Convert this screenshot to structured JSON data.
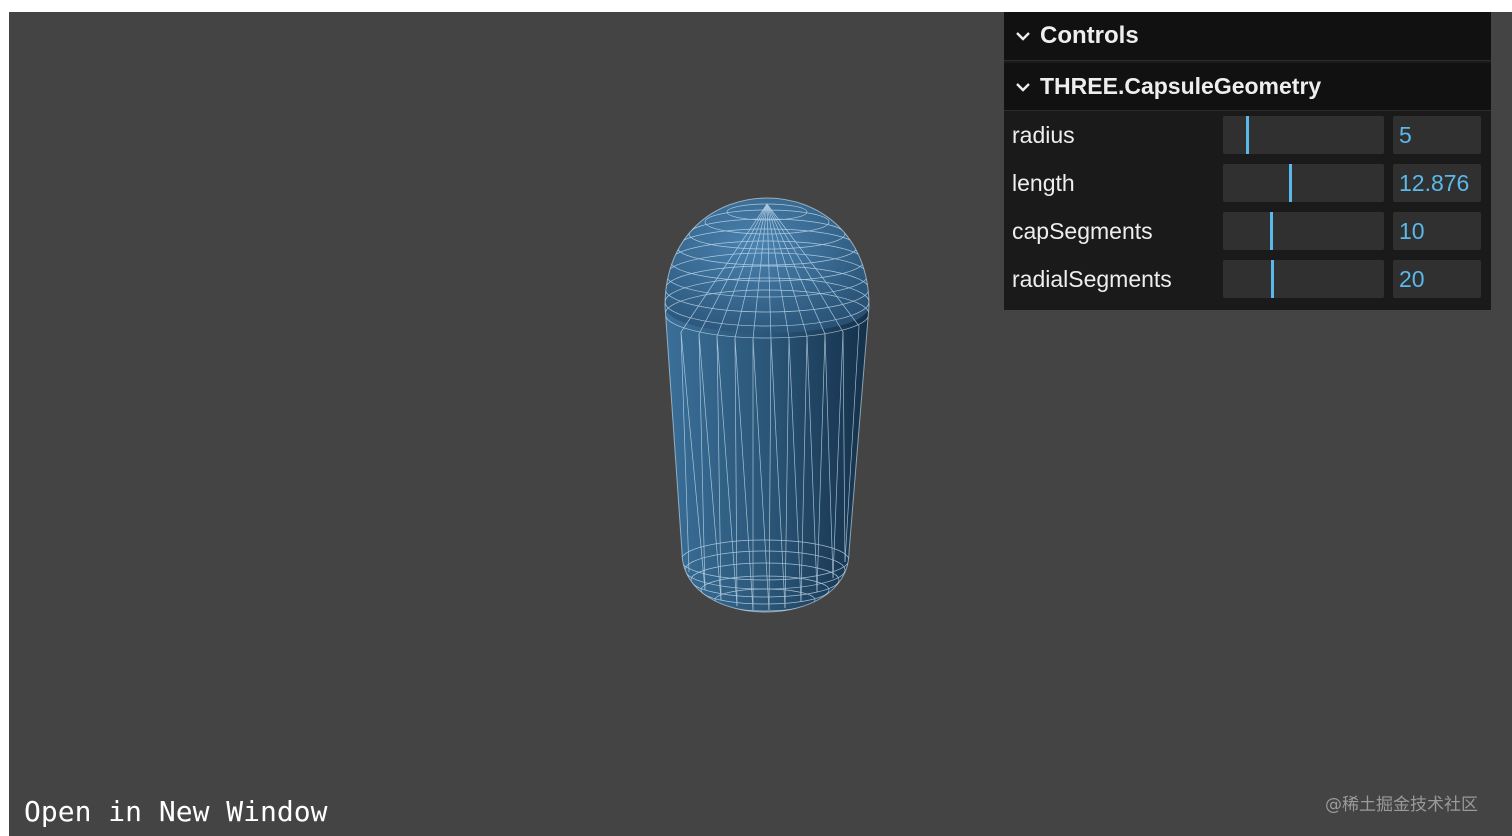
{
  "gui": {
    "title": "Controls",
    "folder": {
      "title": "THREE.CapsuleGeometry",
      "rows": [
        {
          "label": "radius",
          "value": "5",
          "fraction": 0.14
        },
        {
          "label": "length",
          "value": "12.876",
          "fraction": 0.41
        },
        {
          "label": "capSegments",
          "value": "10",
          "fraction": 0.29
        },
        {
          "label": "radialSegments",
          "value": "20",
          "fraction": 0.3
        }
      ]
    }
  },
  "footer": {
    "open_link": "Open in New Window",
    "watermark": "@稀土掘金技术社区"
  },
  "colors": {
    "background": "#444444",
    "panel": "#1a1a1a",
    "accent": "#5ab8ea",
    "mesh": "#2e5f86",
    "wireframe": "#cfe6f7"
  },
  "icons": {
    "controls_toggle": "chevron-down-icon",
    "folder_toggle": "chevron-down-icon"
  }
}
